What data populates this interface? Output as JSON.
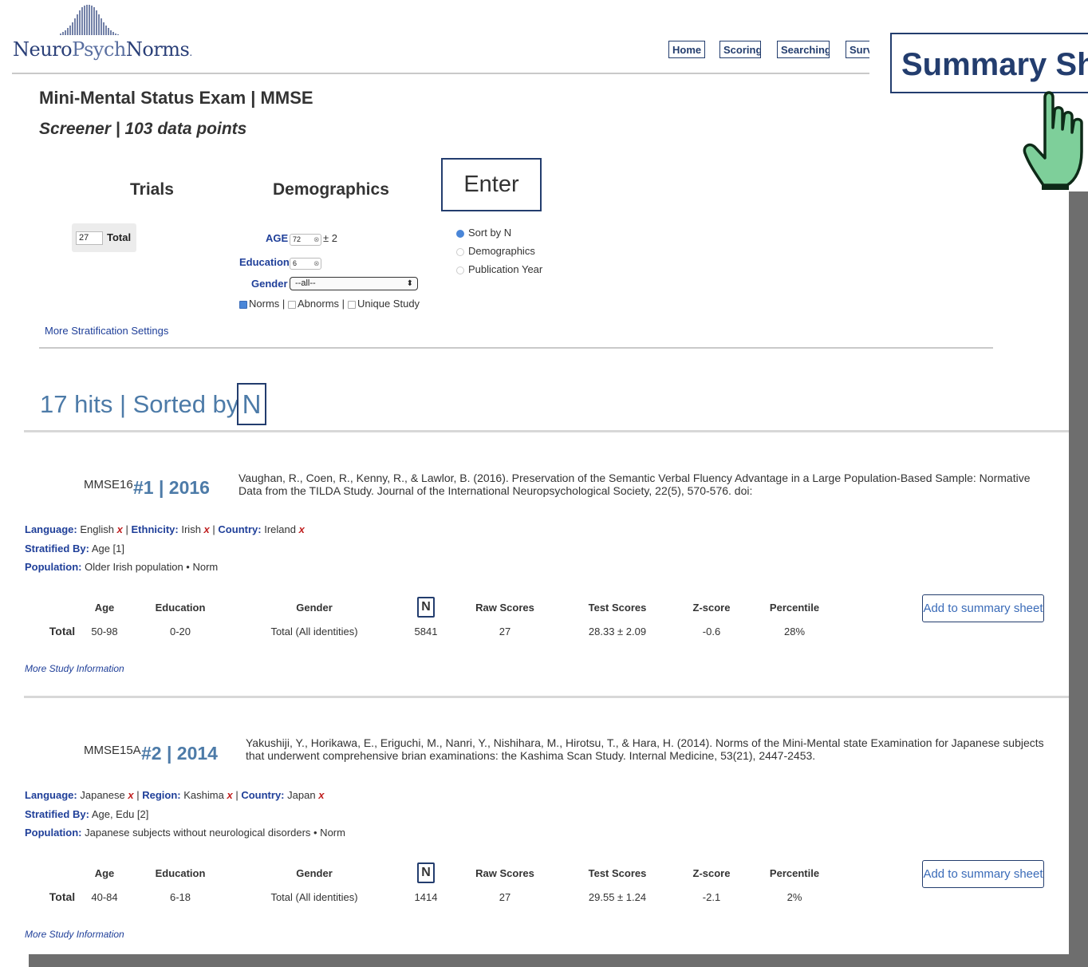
{
  "header": {
    "logo": {
      "neuro": "Neuro",
      "psych": "Psych",
      "norms": "Norms",
      "dot": "."
    },
    "nav": [
      "Home",
      "Scoring",
      "Searching",
      "Surv"
    ],
    "summary_button": "Summary She"
  },
  "test": {
    "title": "Mini-Mental Status Exam | MMSE",
    "subtitle": "Screener | 103 data points"
  },
  "form": {
    "trials_heading": "Trials",
    "demographics_heading": "Demographics",
    "enter_label": "Enter",
    "trial_value": "27",
    "trial_label": "Total",
    "age_label": "AGE",
    "age_value": "72",
    "age_range": "± 2",
    "education_label": "Education",
    "education_value": "6",
    "gender_label": "Gender",
    "gender_selected": "--all--",
    "filter_norms": "Norms |",
    "filter_abnorms": "Abnorms |",
    "filter_unique": "Unique Study",
    "sort_options": [
      "Sort by N",
      "Demographics",
      "Publication Year"
    ],
    "more_stratification": "More Stratification Settings"
  },
  "results": {
    "hits_label": "17 hits | Sorted by",
    "sorted_key": "N",
    "columns": [
      "Age",
      "Education",
      "Gender",
      "N",
      "Raw Scores",
      "Test Scores",
      "Z-score",
      "Percentile"
    ],
    "add_label": "Add to summary sheet",
    "more_info": "More Study Information",
    "items": [
      {
        "code": "MMSE16",
        "rank": "#1 | 2016",
        "citation_line1": "Vaughan, R., Coen, R., Kenny, R., & Lawlor, B. (2016). Preservation of the Semantic Verbal Fluency Advantage in a Large Population-Based Sample: Normative",
        "citation_line2": "Data from the TILDA Study. Journal of the International Neuropsychological Society, 22(5), 570-576. doi:",
        "meta1": {
          "k1": "Language:",
          "v1": "English",
          "k2": "Ethnicity:",
          "v2": "Irish",
          "k3": "Country:",
          "v3": "Ireland",
          "x": "x",
          "sep": "|"
        },
        "stratified_key": "Stratified By:",
        "stratified_val": "Age [1]",
        "population_key": "Population:",
        "population_val": "Older Irish population • Norm",
        "row": {
          "label": "Total",
          "age": "50-98",
          "education": "0-20",
          "gender": "Total (All identities)",
          "n": "5841",
          "raw": "27",
          "test": "28.33 ± 2.09",
          "z": "-0.6",
          "pct": "28%"
        }
      },
      {
        "code": "MMSE15A",
        "rank": "#2 | 2014",
        "citation_line1": "Yakushiji, Y., Horikawa, E., Eriguchi, M., Nanri, Y., Nishihara, M., Hirotsu, T., & Hara, H. (2014). Norms of the Mini-Mental state Examination for Japanese subjects",
        "citation_line2": "that underwent comprehensive brian examinations: the Kashima Scan Study. Internal Medicine, 53(21), 2447-2453.",
        "meta1": {
          "k1": "Language:",
          "v1": "Japanese",
          "k2": "Region:",
          "v2": "Kashima",
          "k3": "Country:",
          "v3": "Japan",
          "x": "x",
          "sep": "|"
        },
        "stratified_key": "Stratified By:",
        "stratified_val": "Age, Edu [2]",
        "population_key": "Population:",
        "population_val": "Japanese subjects without neurological disorders • Norm",
        "row": {
          "label": "Total",
          "age": "40-84",
          "education": "6-18",
          "gender": "Total (All identities)",
          "n": "1414",
          "raw": "27",
          "test": "29.55 ± 1.24",
          "z": "-2.1",
          "pct": "2%"
        }
      }
    ]
  },
  "colors": {
    "navy": "#233d6e",
    "link_blue": "#1f3f99",
    "heading_blue": "#4d7ba8",
    "remove_red": "#c02020",
    "cursor_green": "#7ecf9a"
  },
  "icons": [
    "logo-bell-curve-icon",
    "hand-pointer-icon",
    "clear-circle-icon",
    "select-arrow-icon"
  ]
}
